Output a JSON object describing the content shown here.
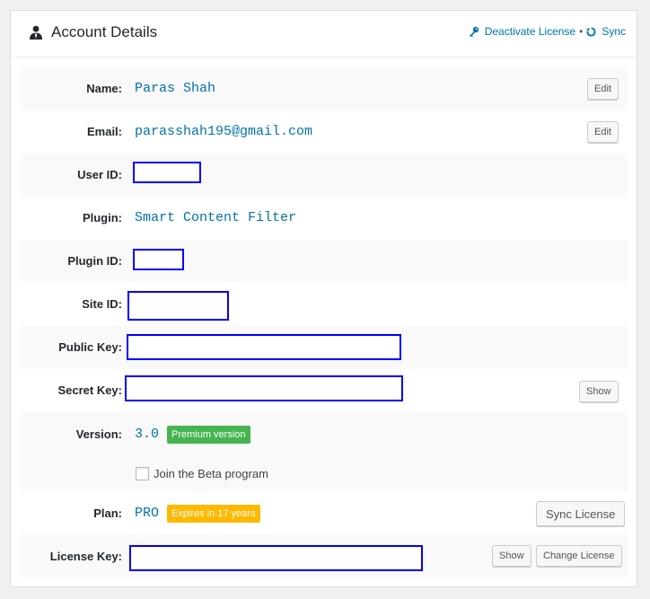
{
  "header": {
    "title": "Account Details",
    "deactivate_label": "Deactivate License",
    "separator": "•",
    "sync_label": "Sync"
  },
  "rows": {
    "name": {
      "label": "Name:",
      "value": "Paras Shah",
      "edit": "Edit"
    },
    "email": {
      "label": "Email:",
      "value": "parasshah195@gmail.com",
      "edit": "Edit"
    },
    "user_id": {
      "label": "User ID:"
    },
    "plugin": {
      "label": "Plugin:",
      "value": "Smart Content Filter"
    },
    "plugin_id": {
      "label": "Plugin ID:"
    },
    "site_id": {
      "label": "Site ID:"
    },
    "public_key": {
      "label": "Public Key:"
    },
    "secret_key": {
      "label": "Secret Key:",
      "show": "Show"
    },
    "version": {
      "label": "Version:",
      "value": "3.0",
      "badge": "Premium version",
      "beta_label": "Join the Beta program",
      "beta_checked": false
    },
    "plan": {
      "label": "Plan:",
      "value": "PRO",
      "badge": "Expires in 17 years",
      "sync_license": "Sync License"
    },
    "license_key": {
      "label": "License Key:",
      "show": "Show",
      "change": "Change License"
    }
  },
  "colors": {
    "link": "#0073aa",
    "premium_badge": "#46b450",
    "expiry_badge": "#ffb900",
    "redaction_border": "#0000ff"
  }
}
